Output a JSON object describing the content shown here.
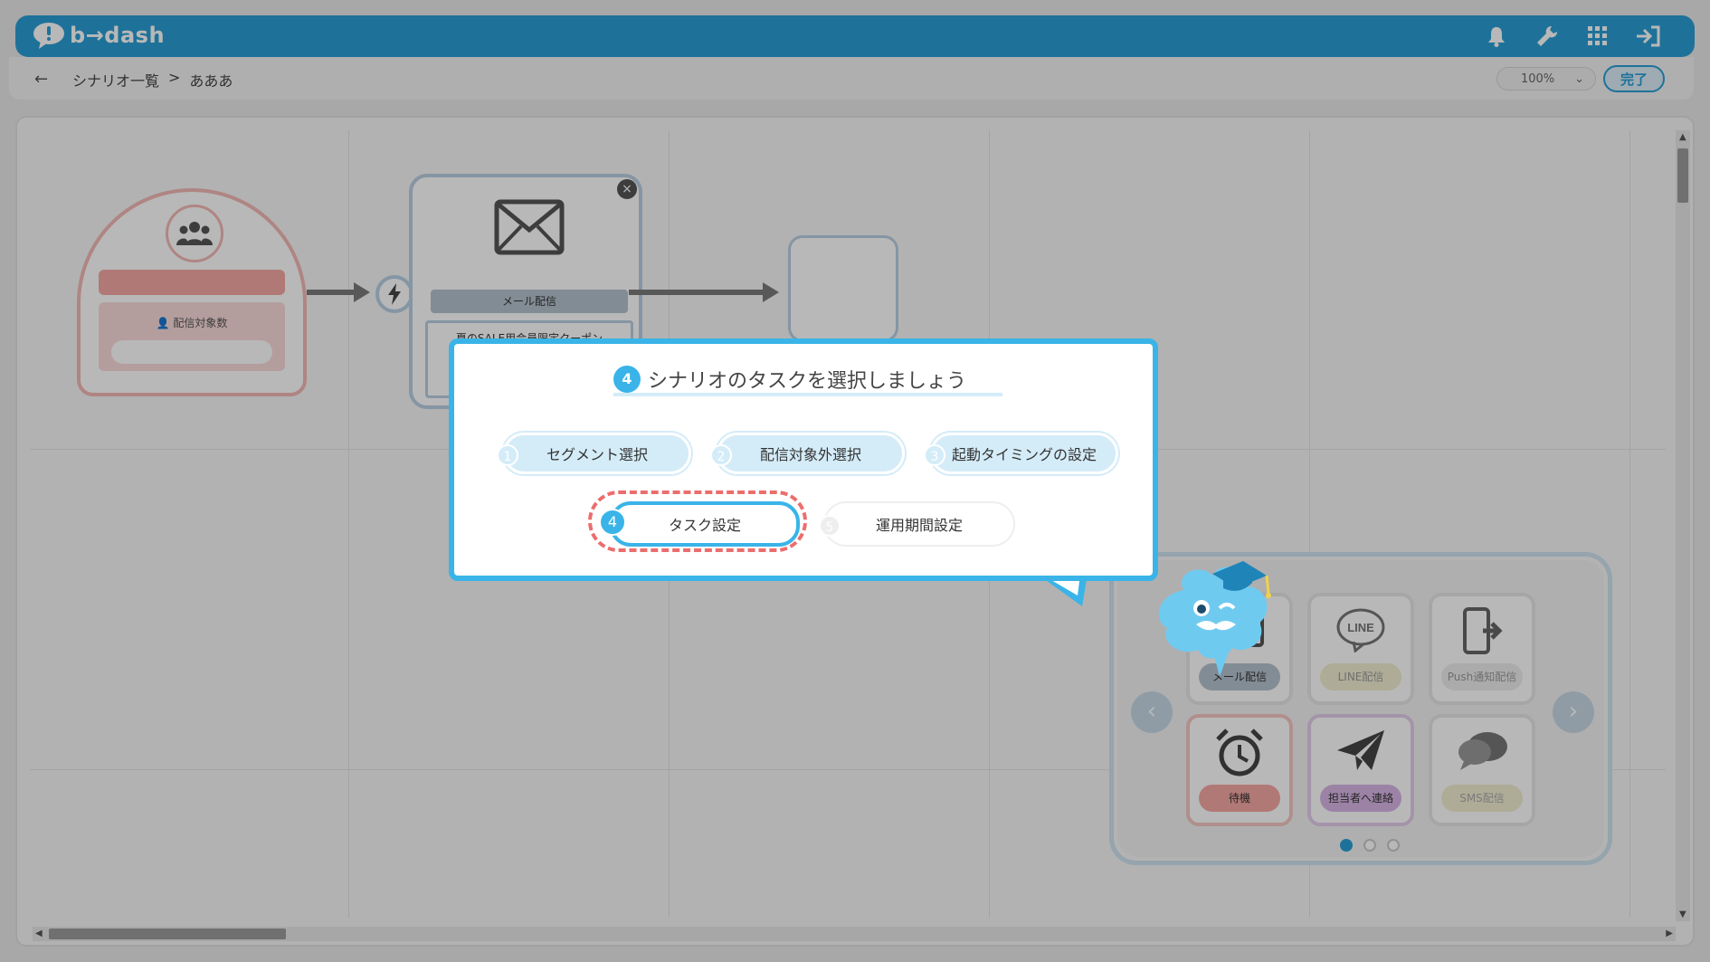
{
  "header": {
    "logo_text": "b→dash"
  },
  "subbar": {
    "breadcrumb": [
      "シナリオ一覧",
      ">",
      "あああ"
    ],
    "zoom": "100%",
    "done_label": "完了"
  },
  "canvas": {
    "start_node": {
      "label": "配信対象数"
    },
    "mail_node": {
      "caption": "メール配信",
      "subject": "夏のSALE用会員限定クーポン"
    }
  },
  "tooltip": {
    "step_number": "4",
    "title": "シナリオのタスクを選択しましょう",
    "steps": [
      {
        "num": "1",
        "label": "セグメント選択"
      },
      {
        "num": "2",
        "label": "配信対象外選択"
      },
      {
        "num": "3",
        "label": "起動タイミングの設定"
      },
      {
        "num": "4",
        "label": "タスク設定"
      },
      {
        "num": "5",
        "label": "運用期間設定"
      }
    ]
  },
  "task_panel": {
    "tiles": [
      {
        "label": "メール配信",
        "icon": "envelope-icon",
        "color": "#b5c2cf"
      },
      {
        "label": "LINE配信",
        "icon": "line-icon",
        "color": "#f2efd2"
      },
      {
        "label": "Push通知配信",
        "icon": "push-phone-icon",
        "color": "#eeeeee"
      },
      {
        "label": "待機",
        "icon": "alarm-clock-icon",
        "color": "#f4a8a4"
      },
      {
        "label": "担当者へ連絡",
        "icon": "paper-plane-icon",
        "color": "#d9b6e6"
      },
      {
        "label": "SMS配信",
        "icon": "chat-bubbles-icon",
        "color": "#f2efd2"
      }
    ],
    "page_dots": 3,
    "active_dot": 0
  },
  "colors": {
    "brand": "#2a9fd6",
    "tooltip_border": "#3ab4e8",
    "highlight_dash": "#ec6d6d"
  }
}
